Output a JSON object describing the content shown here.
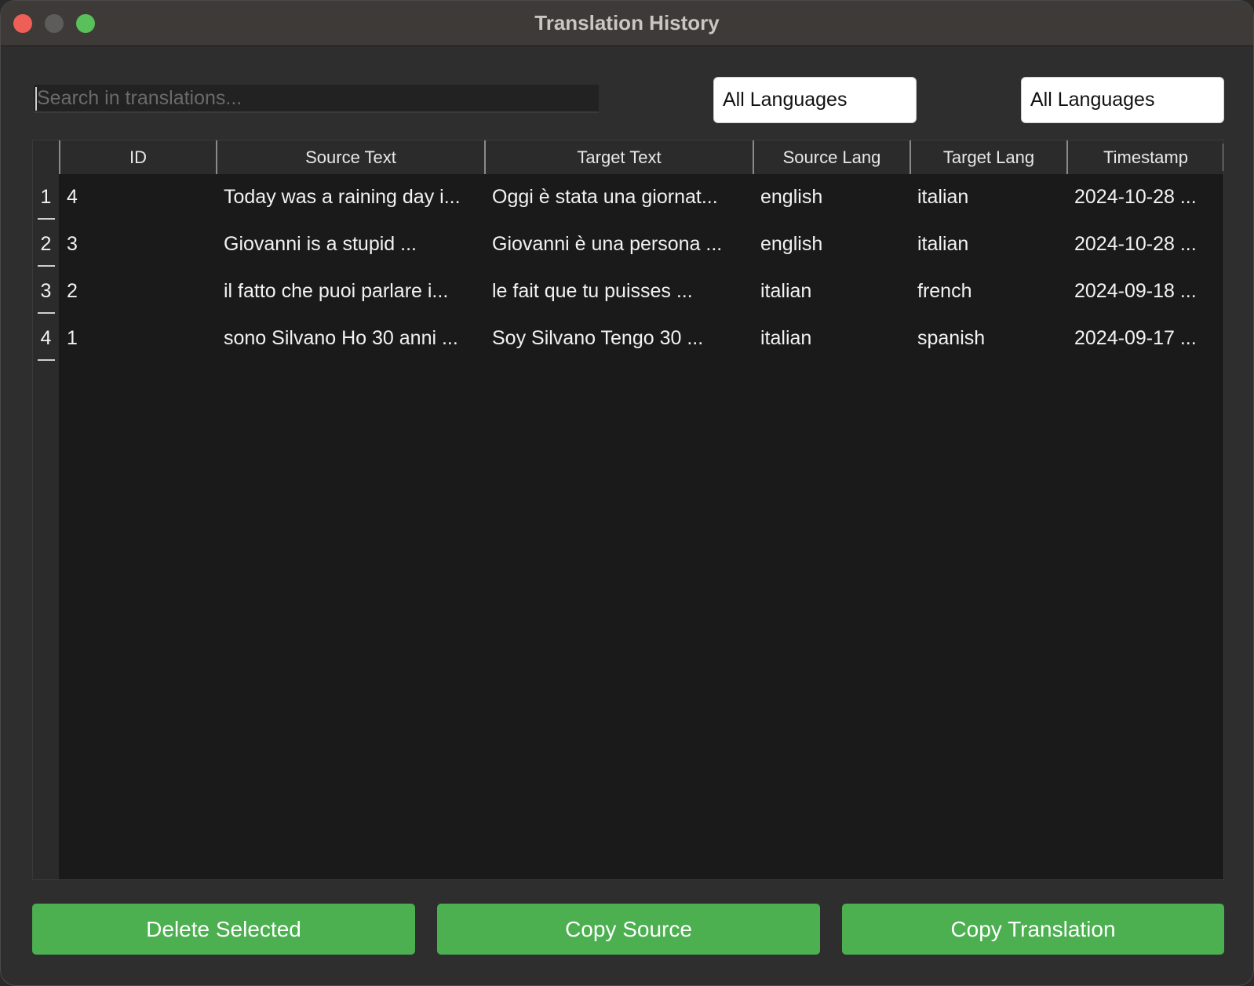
{
  "window": {
    "title": "Translation History"
  },
  "filters": {
    "search_placeholder": "Search in translations...",
    "search_value": "",
    "source_language": "All Languages",
    "target_language": "All Languages"
  },
  "table": {
    "columns": [
      "ID",
      "Source Text",
      "Target Text",
      "Source Lang",
      "Target Lang",
      "Timestamp"
    ],
    "rows": [
      {
        "num": "1",
        "id": "4",
        "source_text": "Today was a raining day i...",
        "target_text": "Oggi è stata una giornat...",
        "source_lang": "english",
        "target_lang": "italian",
        "timestamp": "2024-10-28 ..."
      },
      {
        "num": "2",
        "id": "3",
        "source_text": "Giovanni is a stupid ...",
        "target_text": "Giovanni è una persona ...",
        "source_lang": "english",
        "target_lang": "italian",
        "timestamp": "2024-10-28 ..."
      },
      {
        "num": "3",
        "id": "2",
        "source_text": "il fatto che puoi parlare i...",
        "target_text": "le fait que tu puisses ...",
        "source_lang": "italian",
        "target_lang": "french",
        "timestamp": "2024-09-18 ..."
      },
      {
        "num": "4",
        "id": "1",
        "source_text": "sono Silvano Ho 30 anni ...",
        "target_text": "Soy Silvano Tengo 30 ...",
        "source_lang": "italian",
        "target_lang": "spanish",
        "timestamp": "2024-09-17 ..."
      }
    ]
  },
  "actions": {
    "delete_label": "Delete Selected",
    "copy_source_label": "Copy Source",
    "copy_translation_label": "Copy Translation"
  },
  "colors": {
    "accent_button": "#4caf50",
    "close": "#ee5f57",
    "minimize_inactive": "#5e5c5a",
    "maximize": "#5ac05a"
  }
}
